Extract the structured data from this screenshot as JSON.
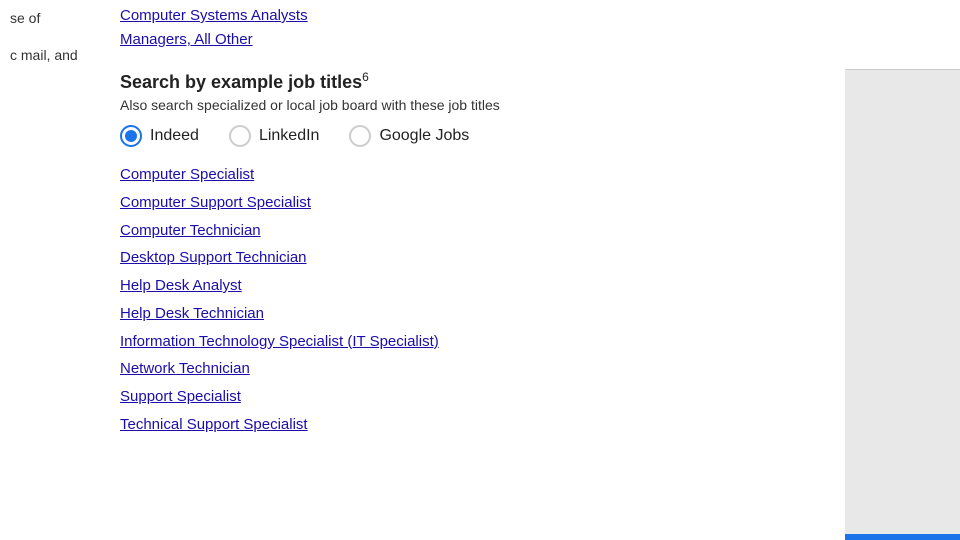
{
  "left": {
    "text1": "se of",
    "text2": "c mail, and"
  },
  "topLinks": [
    {
      "label": "Computer Systems Analysts"
    },
    {
      "label": "Managers, All Other"
    }
  ],
  "section": {
    "title": "Search by example job titles",
    "superscript": "6",
    "subtitle": "Also search specialized or local job board with these job titles"
  },
  "radioOptions": [
    {
      "label": "Indeed",
      "selected": true
    },
    {
      "label": "LinkedIn",
      "selected": false
    },
    {
      "label": "Google Jobs",
      "selected": false
    }
  ],
  "jobLinks": [
    {
      "label": "Computer Specialist"
    },
    {
      "label": "Computer Support Specialist"
    },
    {
      "label": "Computer Technician"
    },
    {
      "label": "Desktop Support Technician"
    },
    {
      "label": "Help Desk Analyst"
    },
    {
      "label": "Help Desk Technician"
    },
    {
      "label": "Information Technology Specialist (IT Specialist)"
    },
    {
      "label": "Network Technician"
    },
    {
      "label": "Support Specialist"
    },
    {
      "label": "Technical Support Specialist"
    }
  ]
}
